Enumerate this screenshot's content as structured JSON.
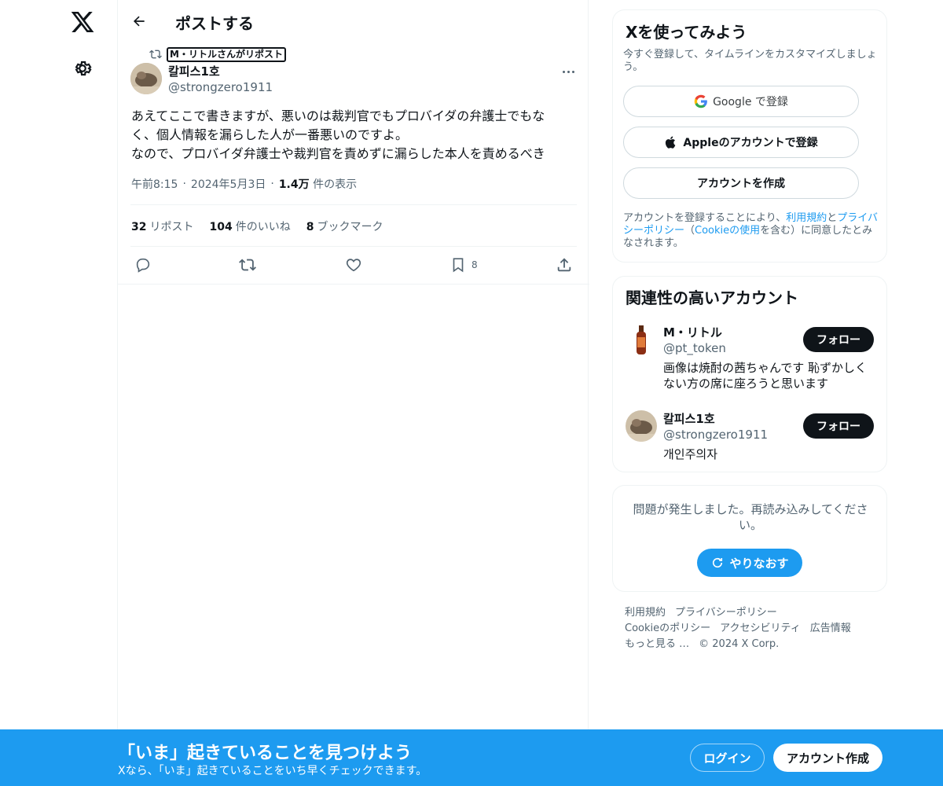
{
  "header": {
    "title": "ポストする",
    "back_icon": "arrow-left-icon"
  },
  "repost": {
    "label": "M・リトルさんがリポスト"
  },
  "tweet": {
    "author_name": "칼피스1호",
    "author_handle": "@strongzero1911",
    "text": "あえてここで書きますが、悪いのは裁判官でもプロバイダの弁護士でもな\nく、個人情報を漏らした人が一番悪いのですよ。\nなので、プロバイダ弁護士や裁判官を責めずに漏らした本人を責めるべき",
    "time": "午前8:15",
    "date": "2024年5月3日",
    "views_count": "1.4万",
    "views_label": "件の表示",
    "reposts_count": "32",
    "reposts_label": "リポスト",
    "likes_count": "104",
    "likes_label": "件のいいね",
    "bookmarks_count": "8",
    "bookmarks_label": "ブックマーク",
    "bookmark_action_count": "8"
  },
  "signup_card": {
    "title": "Xを使ってみよう",
    "subtitle": "今すぐ登録して、タイムラインをカスタマイズしましょう。",
    "google_label": "Google で登録",
    "apple_label": "Appleのアカウントで登録",
    "create_label": "アカウントを作成",
    "terms_pre": "アカウントを登録することにより、",
    "terms_link1": "利用規約",
    "terms_and": "と",
    "terms_link2": "プライバシーポリシー",
    "terms_paren_open": "（",
    "terms_link3": "Cookieの使用",
    "terms_post": "を含む）に同意したとみなされます。"
  },
  "related": {
    "title": "関連性の高いアカウント",
    "accounts": [
      {
        "name": "M・リトル",
        "handle": "@pt_token",
        "bio": "画像は焼酎の茜ちゃんです 恥ずかしくない方の席に座ろうと思います",
        "follow": "フォロー"
      },
      {
        "name": "칼피스1호",
        "handle": "@strongzero1911",
        "bio": "개인주의자",
        "follow": "フォロー"
      }
    ]
  },
  "error_card": {
    "message": "問題が発生しました。再読み込みしてください。",
    "retry": "やりなおす"
  },
  "footer": {
    "links": [
      "利用規約",
      "プライバシーポリシー",
      "Cookieのポリシー",
      "アクセシビリティ",
      "広告情報",
      "もっと見る …",
      "© 2024 X Corp."
    ]
  },
  "banner": {
    "title": "「いま」起きていることを見つけよう",
    "subtitle": "Xなら、「いま」起きていることをいち早くチェックできます。",
    "login": "ログイン",
    "signup": "アカウント作成"
  },
  "colors": {
    "accent": "#1d9bf0",
    "text": "#0f1419",
    "muted": "#536471",
    "border": "#eff3f4"
  }
}
